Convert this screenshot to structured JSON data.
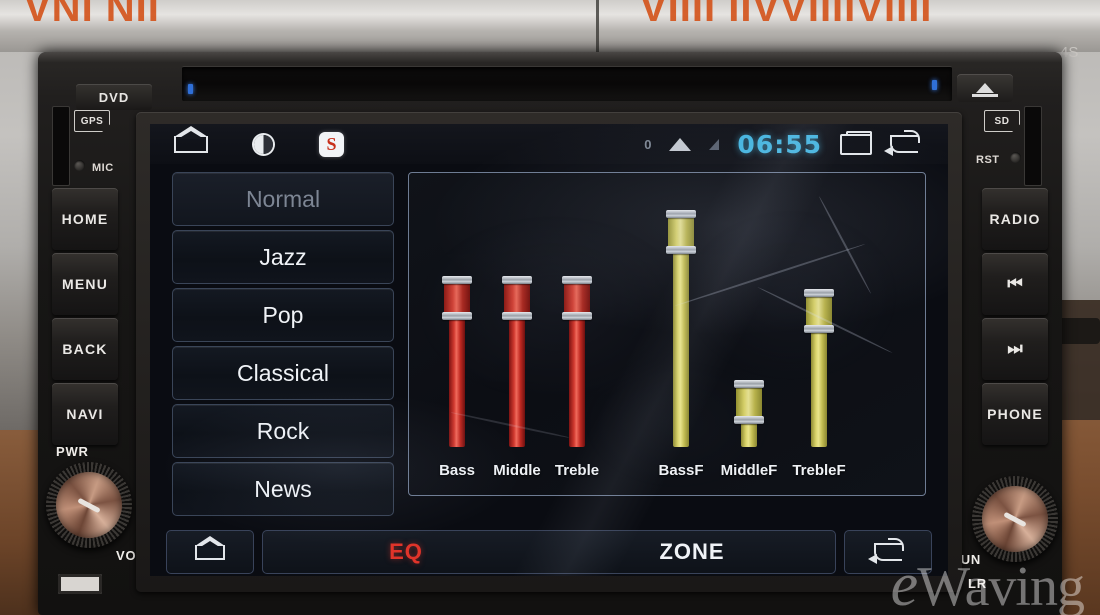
{
  "background": {
    "top_text_left": "VNI NII",
    "top_text_right": "VIIII IIVVIIIIVIIII",
    "corner_text": "4S"
  },
  "device": {
    "dvd_label": "DVD",
    "eject_icon": "eject-icon",
    "left_panel": {
      "card_label": "GPS",
      "mic_label": "MIC",
      "buttons": [
        {
          "label": "HOME",
          "name": "home-hardware-button"
        },
        {
          "label": "MENU",
          "name": "menu-hardware-button"
        },
        {
          "label": "BACK",
          "name": "back-hardware-button"
        },
        {
          "label": "NAVI",
          "name": "navi-hardware-button"
        }
      ],
      "knob_top_label": "PWR",
      "knob_bottom_label": "VOL",
      "usb_icon": "usb-icon"
    },
    "right_panel": {
      "card_label": "SD",
      "reset_label": "RST",
      "buttons": [
        {
          "label": "RADIO",
          "name": "radio-hardware-button",
          "glyph": ""
        },
        {
          "label": "",
          "name": "previous-track-button",
          "glyph": "⏮"
        },
        {
          "label": "",
          "name": "next-track-button",
          "glyph": "⏭"
        },
        {
          "label": "PHONE",
          "name": "phone-hardware-button",
          "glyph": ""
        }
      ],
      "knob_top_label": "TUN",
      "knob_bottom_label": "LR"
    }
  },
  "screen": {
    "statusbar": {
      "home_icon": "home-icon",
      "brightness_icon": "brightness-icon",
      "app_icon_letter": "S",
      "notification_count": "0",
      "wifi_icon": "wifi-icon",
      "signal_icon": "signal-icon",
      "time": "06:55",
      "recents_icon": "recents-icon",
      "back_icon": "back-icon"
    },
    "presets": [
      {
        "label": "Normal",
        "selected": true
      },
      {
        "label": "Jazz",
        "selected": false
      },
      {
        "label": "Pop",
        "selected": false
      },
      {
        "label": "Classical",
        "selected": false
      },
      {
        "label": "Rock",
        "selected": false
      },
      {
        "label": "News",
        "selected": false
      }
    ],
    "sliders": [
      {
        "label": "Bass",
        "color": "red",
        "value": 62,
        "hex": "#c8372c"
      },
      {
        "label": "Middle",
        "color": "red",
        "value": 62,
        "hex": "#c8372c"
      },
      {
        "label": "Treble",
        "color": "red",
        "value": 62,
        "hex": "#c8372c"
      },
      {
        "label": "BassF",
        "color": "yellow",
        "value": 92,
        "hex": "#d9d36a"
      },
      {
        "label": "MiddleF",
        "color": "yellow",
        "value": 14,
        "hex": "#d9d36a"
      },
      {
        "label": "TrebleF",
        "color": "yellow",
        "value": 56,
        "hex": "#d9d36a"
      }
    ],
    "navbar": {
      "home_icon": "home-icon",
      "eq_label": "EQ",
      "zone_label": "ZONE",
      "back_icon": "back-icon",
      "active_color": "#e0342a"
    }
  },
  "watermark": {
    "text": "Waving",
    "mark": "e"
  }
}
